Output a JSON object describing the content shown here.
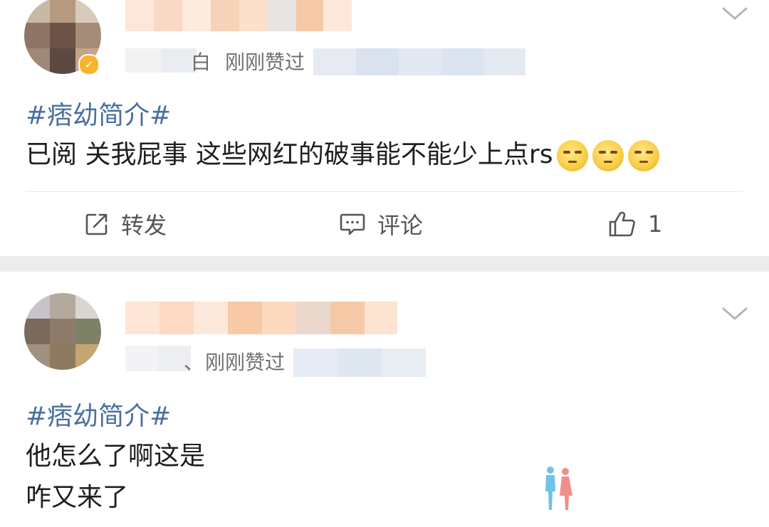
{
  "colors": {
    "topic_link": "#4a6f9e",
    "separator": "#ececec",
    "meta_text": "#6f6f6f",
    "verified_badge": "#f7b52c"
  },
  "posts": [
    {
      "meta_partial": "白",
      "meta_liked": "刚刚赞过",
      "topic": "#痞幼简介#",
      "content": "已阅 关我屁事 这些网红的破事能不能少上点rs",
      "emoji_icon": "smirk-face-emoji",
      "emoji_count": 3,
      "actions": {
        "repost_label": "转发",
        "comment_label": "评论",
        "like_count": "1"
      }
    },
    {
      "meta_partial": "、",
      "meta_liked": "刚刚赞过",
      "topic": "#痞幼简介#",
      "content_lines": [
        "他怎么了啊这是",
        "咋又来了"
      ]
    }
  ]
}
